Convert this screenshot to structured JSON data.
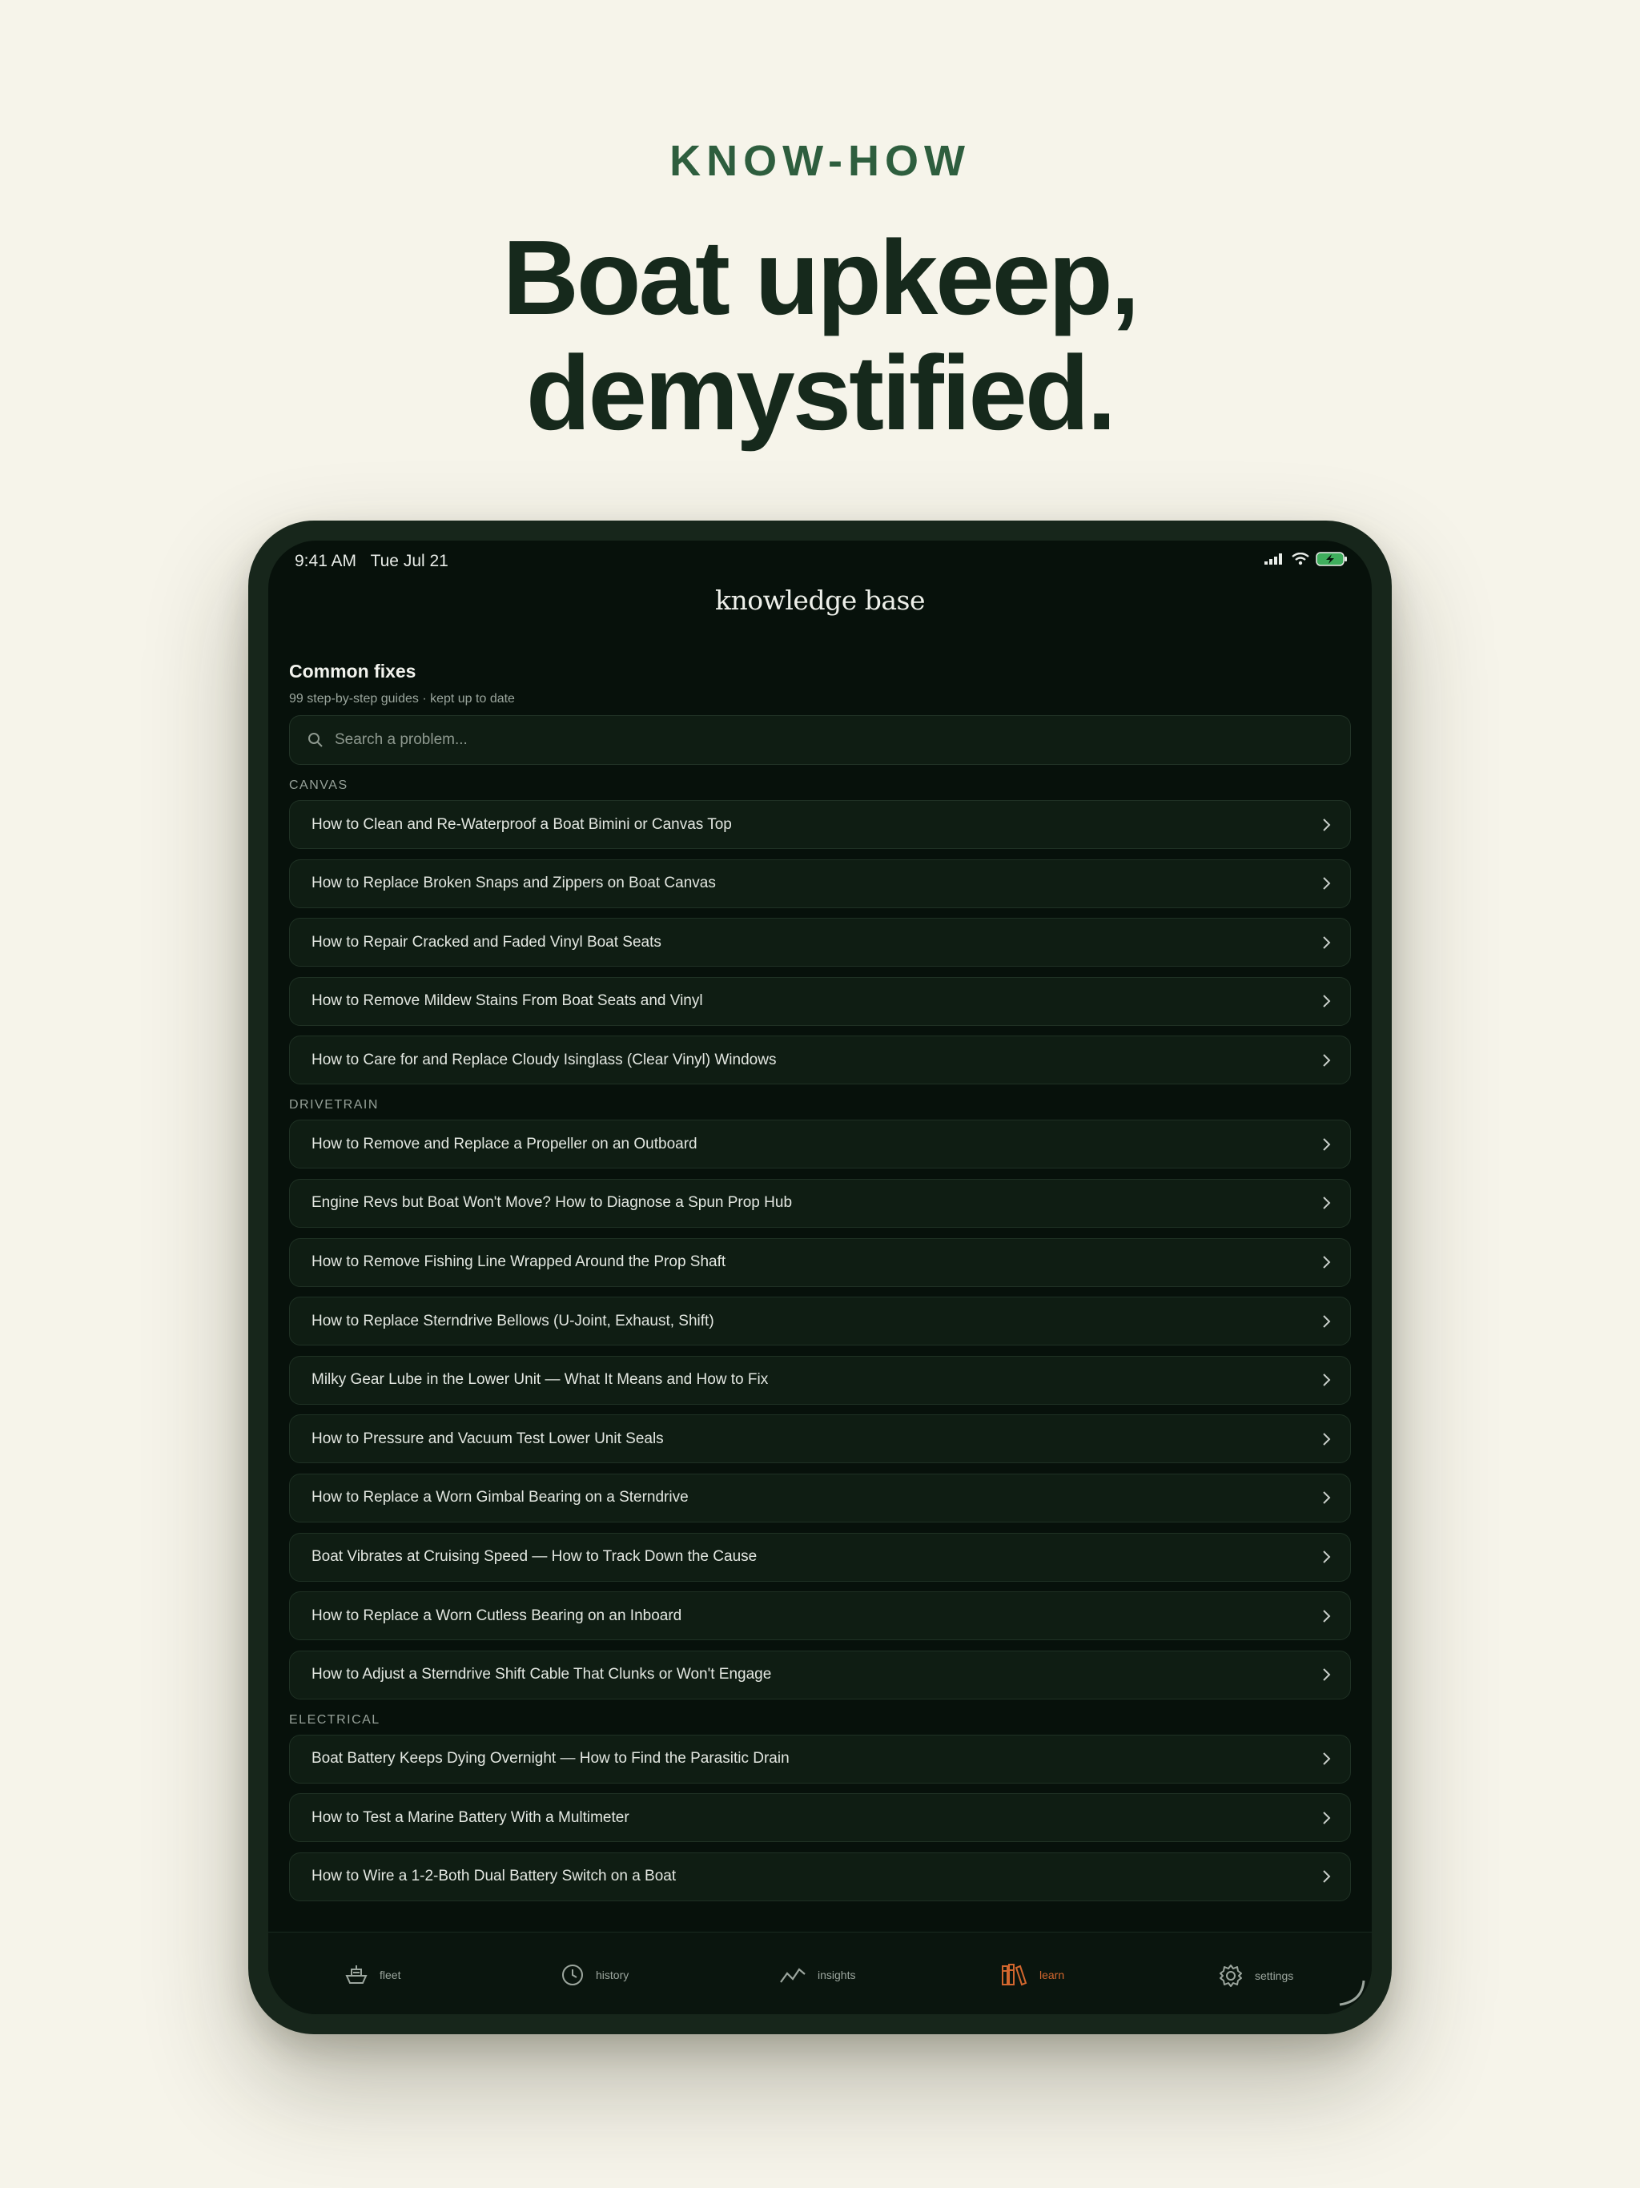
{
  "hero": {
    "eyebrow": "KNOW-HOW",
    "headline_line1": "Boat upkeep,",
    "headline_line2": "demystified."
  },
  "status_bar": {
    "time": "9:41 AM",
    "date": "Tue Jul 21",
    "icons": [
      "cellular-signal-icon",
      "wifi-icon",
      "battery-charging-icon"
    ]
  },
  "nav": {
    "title": "knowledge base"
  },
  "section": {
    "title": "Common fixes",
    "subtitle": "99 step-by-step guides · kept up to date"
  },
  "search": {
    "placeholder": "Search a problem..."
  },
  "groups": [
    {
      "label": "CANVAS",
      "items": [
        "How to Clean and Re-Waterproof a Boat Bimini or Canvas Top",
        "How to Replace Broken Snaps and Zippers on Boat Canvas",
        "How to Repair Cracked and Faded Vinyl Boat Seats",
        "How to Remove Mildew Stains From Boat Seats and Vinyl",
        "How to Care for and Replace Cloudy Isinglass (Clear Vinyl) Windows"
      ]
    },
    {
      "label": "DRIVETRAIN",
      "items": [
        "How to Remove and Replace a Propeller on an Outboard",
        "Engine Revs but Boat Won't Move? How to Diagnose a Spun Prop Hub",
        "How to Remove Fishing Line Wrapped Around the Prop Shaft",
        "How to Replace Sterndrive Bellows (U-Joint, Exhaust, Shift)",
        "Milky Gear Lube in the Lower Unit — What It Means and How to Fix",
        "How to Pressure and Vacuum Test Lower Unit Seals",
        "How to Replace a Worn Gimbal Bearing on a Sterndrive",
        "Boat Vibrates at Cruising Speed — How to Track Down the Cause",
        "How to Replace a Worn Cutless Bearing on an Inboard",
        "How to Adjust a Sterndrive Shift Cable That Clunks or Won't Engage"
      ]
    },
    {
      "label": "ELECTRICAL",
      "items": [
        "Boat Battery Keeps Dying Overnight — How to Find the Parasitic Drain",
        "How to Test a Marine Battery With a Multimeter",
        "How to Wire a 1-2-Both Dual Battery Switch on a Boat"
      ]
    }
  ],
  "tabs": [
    {
      "label": "fleet",
      "icon": "boat-icon",
      "active": false
    },
    {
      "label": "history",
      "icon": "clock-icon",
      "active": false
    },
    {
      "label": "insights",
      "icon": "trend-line-icon",
      "active": false
    },
    {
      "label": "learn",
      "icon": "books-icon",
      "active": true
    },
    {
      "label": "settings",
      "icon": "gear-icon",
      "active": false
    }
  ],
  "colors": {
    "page_background": "#f6f4ea",
    "eyebrow": "#2e5e3e",
    "headline": "#16291c",
    "screen_background": "#07110b",
    "row_background": "#0f1d13",
    "active_tab": "#d3672e"
  }
}
